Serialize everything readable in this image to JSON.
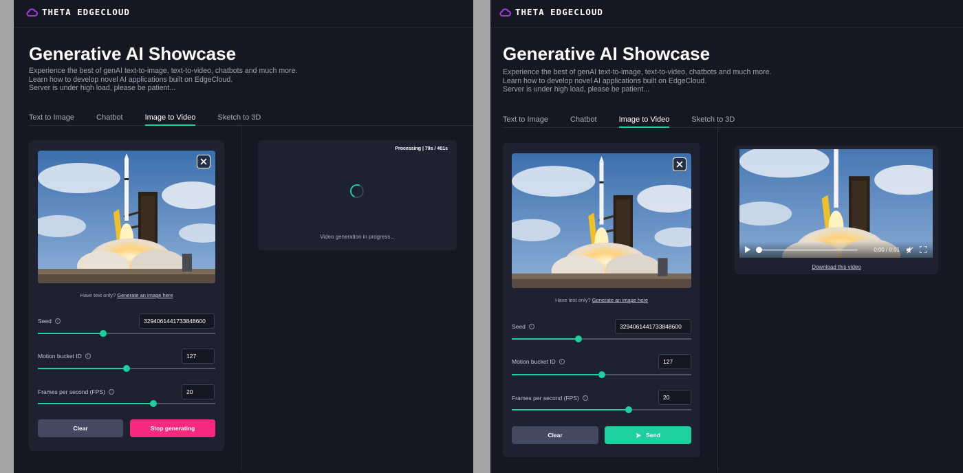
{
  "brand": "THETA EDGECLOUD",
  "title": "Generative AI Showcase",
  "description": [
    "Experience the best of genAI text-to-image, text-to-video, chatbots and much more.",
    "Learn how to develop novel AI applications built on EdgeCloud.",
    "Server is under high load, please be patient..."
  ],
  "tabs": [
    "Text to Image",
    "Chatbot",
    "Image to Video",
    "Sketch to 3D"
  ],
  "active_tab": "Image to Video",
  "help_prefix": "Have text only?",
  "help_link": "Generate an image here",
  "fields": {
    "seed": {
      "label": "Seed",
      "value": "3294061441733848600",
      "level": 0.37
    },
    "motion": {
      "label": "Motion bucket ID",
      "value": "127",
      "level": 0.5
    },
    "fps": {
      "label": "Frames per second (FPS)",
      "value": "20",
      "level": 0.65
    }
  },
  "left_panel": {
    "clear_label": "Clear",
    "stop_label": "Stop generating",
    "processing": "Processing | 79s / 401s",
    "progress_message": "Video generation in progress..."
  },
  "right_panel": {
    "clear_label": "Clear",
    "send_label": "Send",
    "video_time": "0:00 / 0:01",
    "download_label": "Download this video"
  },
  "colors": {
    "background": "#151823",
    "card": "#1e2230",
    "accent": "#1ecfa0",
    "stop_button": "#f7297f",
    "clear_button": "#434960",
    "logo": "#a53fe0"
  }
}
